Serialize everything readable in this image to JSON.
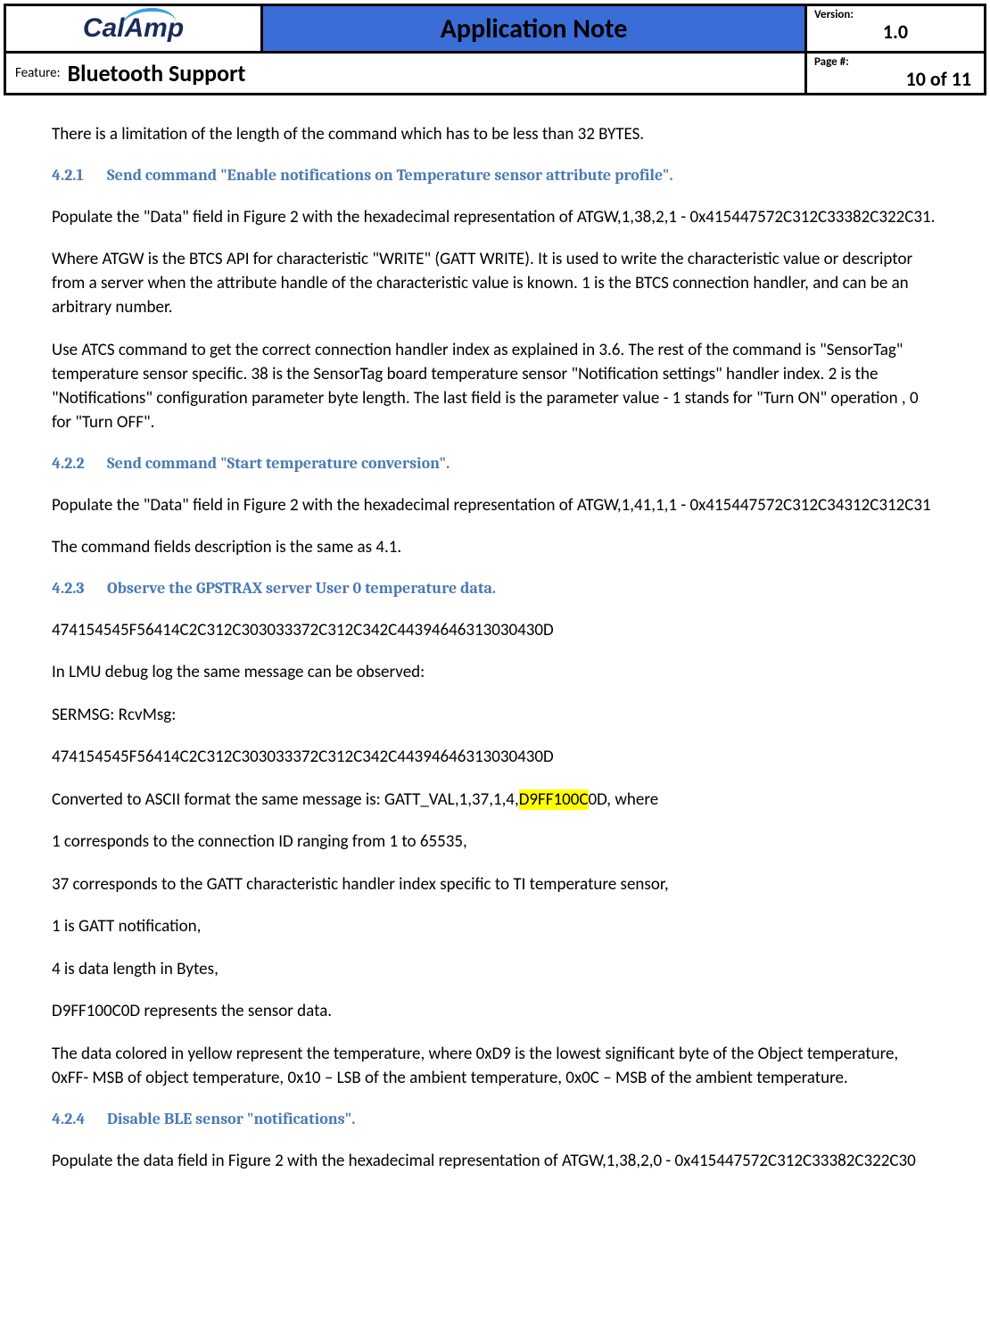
{
  "header": {
    "logo_text": "CalAmp",
    "title": "Application Note",
    "version_label": "Version:",
    "version_value": "1.0",
    "feature_label": "Feature:",
    "feature_value": "Bluetooth Support",
    "page_label": "Page #:",
    "page_value": "10 of 11"
  },
  "body": {
    "intro": "There is a limitation of the length of the command which has to be less than 32 BYTES.",
    "s421": {
      "num": "4.2.1",
      "title": "Send command \"Enable notifications on Temperature sensor attribute profile\".",
      "p1": "Populate the \"Data\" field in Figure 2 with the hexadecimal representation of ATGW,1,38,2,1 - 0x415447572C312C33382C322C31.",
      "p2": " Where ATGW is the BTCS  API for  characteristic \"WRITE\" (GATT WRITE). It is used to write the characteristic value or descriptor from a server when the attribute handle of the characteristic value is known. 1 is the BTCS  connection handler, and can be an arbitrary number.",
      "p3": "Use ATCS command to get the correct connection handler index as explained in 3.6. The rest of the command is \"SensorTag\" temperature sensor specific.  38 is the SensorTag board temperature sensor \"Notification settings\" handler index. 2 is the \"Notifications\" configuration parameter byte length. The last field is the parameter value - 1 stands for \"Turn ON\" operation , 0 for \"Turn OFF\"."
    },
    "s422": {
      "num": "4.2.2",
      "title": "Send command \"Start temperature conversion\".",
      "p1": "Populate the \"Data\" field in Figure 2 with the hexadecimal representation of ATGW,1,41,1,1 - 0x415447572C312C34312C312C31",
      "p2": "The command fields description is the same as 4.1."
    },
    "s423": {
      "num": "4.2.3",
      "title": "Observe the GPSTRAX server User 0 temperature data.",
      "hex_long": "474154545F56414C2C312C303033372C312C342C44394646313030430D",
      "l1": "In LMU debug log the same message can be observed:",
      "l2": "SERMSG: RcvMsg:",
      "l3": "474154545F56414C2C312C303033372C312C342C44394646313030430D",
      "l4a": "Converted to ASCII format the same message is:   GATT_VAL,1,37,1,4,",
      "l4hl": "D9FF100C",
      "l4b": "0D, where",
      "l5": "1 corresponds to the connection ID ranging from 1 to 65535,",
      "l6": "37 corresponds to the GATT characteristic handler index specific to TI temperature sensor,",
      "l7": "1 is  GATT notification,",
      "l8": "4 is  data length in Bytes,",
      "l9": "D9FF100C0D  represents the sensor data.",
      "p_after": "The data colored in yellow represent the temperature, where 0xD9 is the lowest significant byte of the Object temperature, 0xFF- MSB of object temperature, 0x10 – LSB of the ambient temperature, 0x0C – MSB of the ambient temperature."
    },
    "s424": {
      "num": "4.2.4",
      "title": "Disable BLE sensor \"notifications\".",
      "p1": "Populate the data field in Figure 2 with the hexadecimal representation of  ATGW,1,38,2,0 - 0x415447572C312C33382C322C30"
    }
  }
}
